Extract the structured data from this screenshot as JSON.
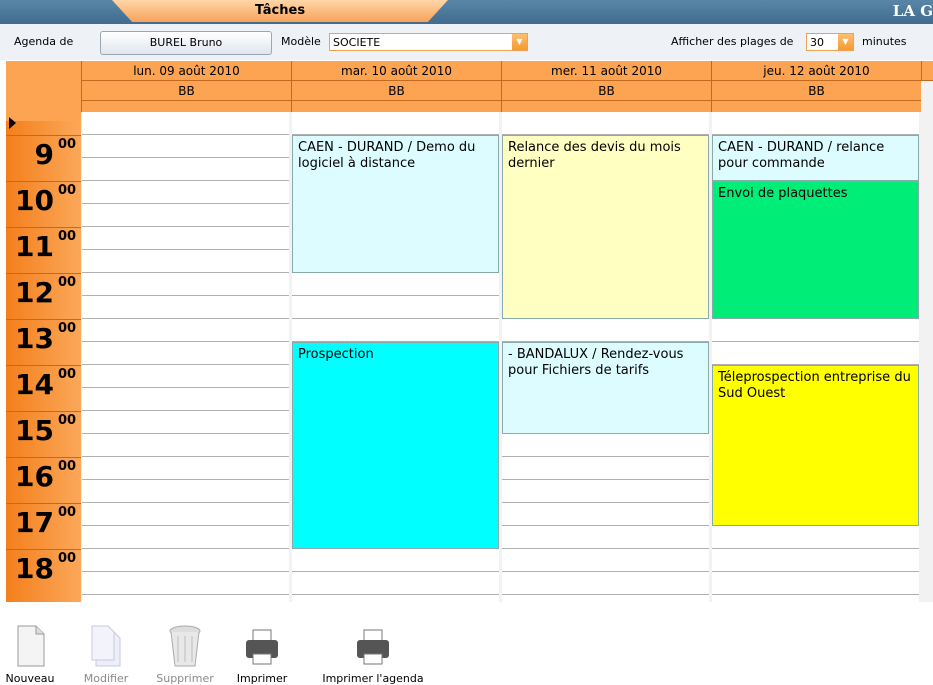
{
  "header": {
    "tab_title": "Tâches",
    "brand": "LA G"
  },
  "toolbar": {
    "agenda_label": "Agenda de",
    "agenda_value": "BUREL Bruno",
    "model_label": "Modèle",
    "model_value": "SOCIETE",
    "slots_label": "Afficher des plages de",
    "slots_value": "30",
    "slots_unit": "minutes"
  },
  "calendar": {
    "days": [
      {
        "date": "lun. 09 août 2010",
        "user": "BB"
      },
      {
        "date": "mar. 10 août 2010",
        "user": "BB"
      },
      {
        "date": "mer. 11 août 2010",
        "user": "BB"
      },
      {
        "date": "jeu. 12 août 2010",
        "user": "BB"
      }
    ],
    "hours": [
      "9",
      "10",
      "11",
      "12",
      "13",
      "14",
      "15",
      "16",
      "17",
      "18"
    ],
    "minutes_suffix": "00",
    "events": [
      {
        "day": 1,
        "start": "09:00",
        "end": "12:00",
        "text": "CAEN - DURAND  / Demo du logiciel à distance",
        "color": "#dcfcff"
      },
      {
        "day": 2,
        "start": "09:00",
        "end": "13:00",
        "text": "Relance des devis du mois dernier",
        "color": "#ffffc2"
      },
      {
        "day": 3,
        "start": "09:00",
        "end": "10:00",
        "text": "CAEN - DURAND  / relance pour commande",
        "color": "#dcfcff"
      },
      {
        "day": 3,
        "start": "10:00",
        "end": "13:00",
        "text": "Envoi de plaquettes",
        "color": "#00ee78"
      },
      {
        "day": 1,
        "start": "13:30",
        "end": "18:00",
        "text": "Prospection",
        "color": "#00ffff"
      },
      {
        "day": 2,
        "start": "13:30",
        "end": "15:30",
        "text": " - BANDALUX  / Rendez-vous pour Fichiers de tarifs",
        "color": "#dcfcff"
      },
      {
        "day": 3,
        "start": "14:00",
        "end": "17:30",
        "text": "Téleprospection entreprise du Sud Ouest",
        "color": "#ffff00"
      }
    ]
  },
  "actions": [
    {
      "label": "Nouveau",
      "icon": "new-document-icon",
      "enabled": true
    },
    {
      "label": "Modifier",
      "icon": "edit-document-icon",
      "enabled": false
    },
    {
      "label": "Supprimer",
      "icon": "trash-icon",
      "enabled": false
    },
    {
      "label": "Imprimer",
      "icon": "printer-icon",
      "enabled": true
    },
    {
      "label": "Imprimer l'agenda",
      "icon": "printer-agenda-icon",
      "enabled": true
    }
  ]
}
